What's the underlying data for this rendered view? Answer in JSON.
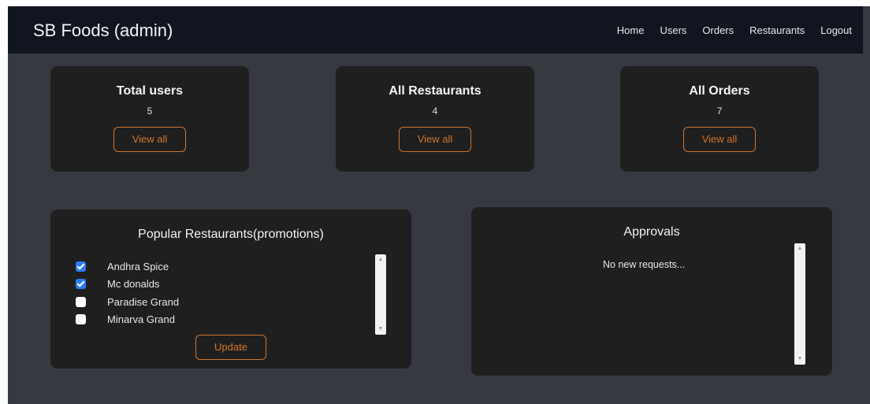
{
  "navbar": {
    "brand": "SB Foods (admin)",
    "links": [
      "Home",
      "Users",
      "Orders",
      "Restaurants",
      "Logout"
    ]
  },
  "stats": [
    {
      "title": "Total users",
      "value": "5",
      "button": "View all"
    },
    {
      "title": "All Restaurants",
      "value": "4",
      "button": "View all"
    },
    {
      "title": "All Orders",
      "value": "7",
      "button": "View all"
    }
  ],
  "promotions": {
    "title": "Popular Restaurants(promotions)",
    "items": [
      {
        "label": "Andhra Spice",
        "checked": true
      },
      {
        "label": "Mc donalds",
        "checked": true
      },
      {
        "label": "Paradise Grand",
        "checked": false
      },
      {
        "label": "Minarva Grand",
        "checked": false
      }
    ],
    "button": "Update"
  },
  "approvals": {
    "title": "Approvals",
    "message": "No new requests..."
  },
  "colors": {
    "background": "#363940",
    "navbar": "#111520",
    "card": "#1f1f1f",
    "accent": "#d1742c",
    "checkbox": "#2e7bf6"
  },
  "icons": {
    "scroll_up": "scroll-up-arrow-icon",
    "scroll_down": "scroll-down-arrow-icon",
    "checkmark": "checkmark-icon"
  }
}
